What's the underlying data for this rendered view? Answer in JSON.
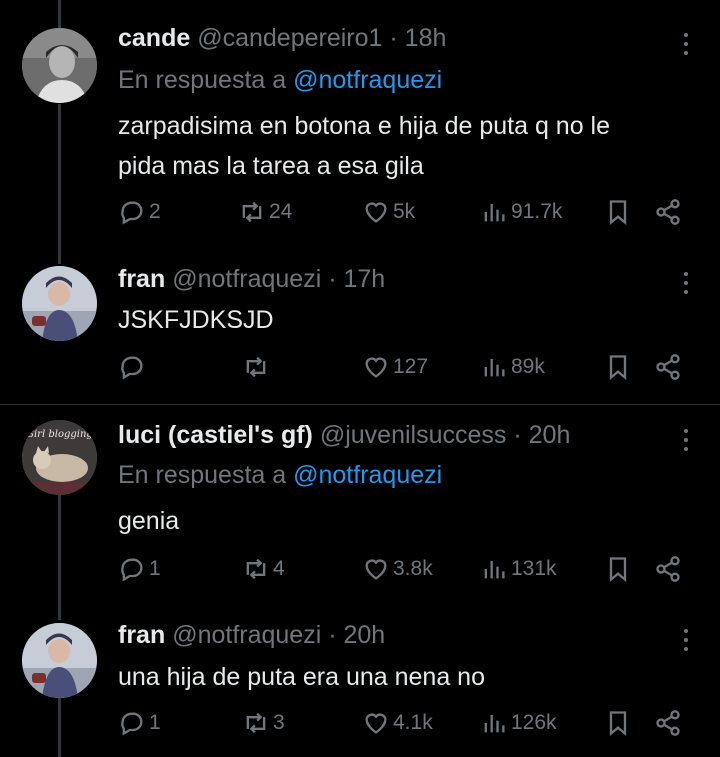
{
  "tweets": [
    {
      "name": "cande",
      "handle": "@candepereiro1",
      "time": "18h",
      "reply_prefix": "En respuesta a",
      "reply_to": "@notfraquezi",
      "text_lines": [
        "zarpadisima en botona e hija de puta q no le",
        "pida mas la tarea a esa gila"
      ],
      "replies": "2",
      "retweets": "24",
      "likes": "5k",
      "views": "91.7k"
    },
    {
      "name": "fran",
      "handle": "@notfraquezi",
      "time": "17h",
      "text_lines": [
        "JSKFJDKSJD"
      ],
      "replies": "",
      "retweets": "",
      "likes": "127",
      "views": "89k"
    },
    {
      "name": "luci (castiel's gf)",
      "handle": "@juvenilsuccess",
      "time": "20h",
      "reply_prefix": "En respuesta a",
      "reply_to": "@notfraquezi",
      "avatar_text": "Girl blogging",
      "text_lines": [
        "genia"
      ],
      "replies": "1",
      "retweets": "4",
      "likes": "3.8k",
      "views": "131k"
    },
    {
      "name": "fran",
      "handle": "@notfraquezi",
      "time": "20h",
      "text_lines": [
        "una hija de puta era una nena no"
      ],
      "replies": "1",
      "retweets": "3",
      "likes": "4.1k",
      "views": "126k"
    }
  ],
  "separator": "·",
  "colors": {
    "background": "#000000",
    "text": "#e7e9ea",
    "secondary": "#71767b",
    "link": "#1d9bf0",
    "divider": "#2f3336"
  },
  "icons": [
    "reply-icon",
    "retweet-icon",
    "like-icon",
    "views-icon",
    "bookmark-icon",
    "share-icon",
    "more-icon"
  ]
}
